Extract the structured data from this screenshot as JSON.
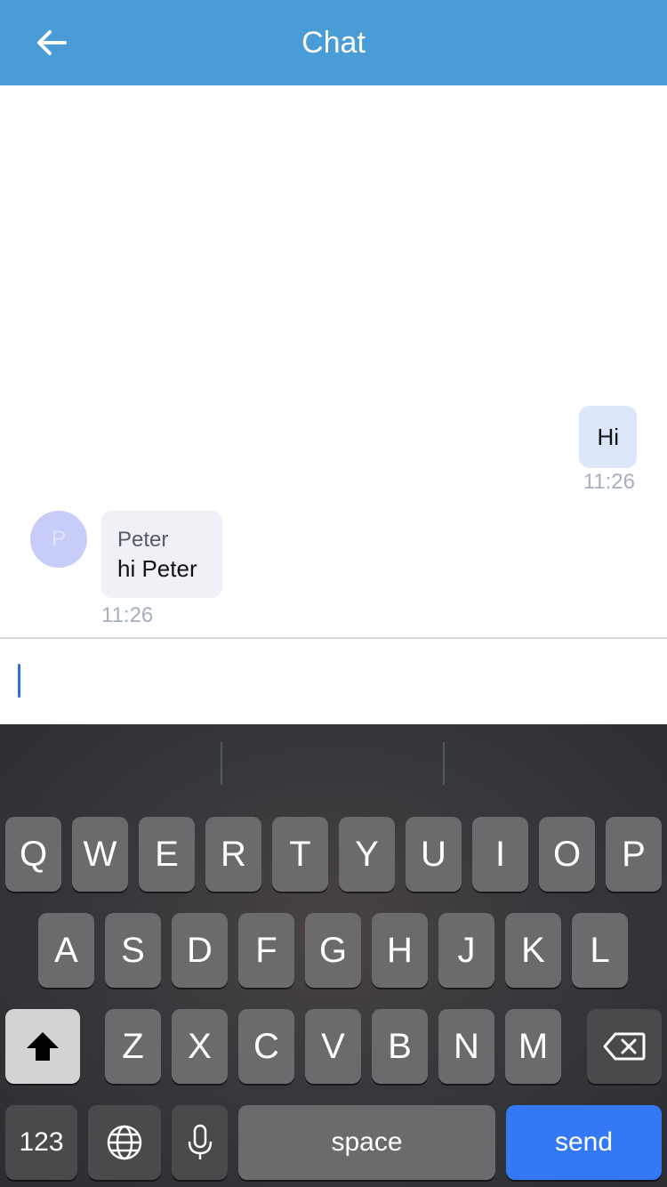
{
  "header": {
    "title": "Chat",
    "back_icon": "arrow-left-icon"
  },
  "messages": [
    {
      "direction": "outgoing",
      "text": "Hi",
      "time": "11:26"
    },
    {
      "direction": "incoming",
      "sender": "Peter",
      "avatar_initial": "P",
      "text": "hi Peter",
      "time": "11:26"
    }
  ],
  "composer": {
    "value": ""
  },
  "keyboard": {
    "row1": [
      "Q",
      "W",
      "E",
      "R",
      "T",
      "Y",
      "U",
      "I",
      "O",
      "P"
    ],
    "row2": [
      "A",
      "S",
      "D",
      "F",
      "G",
      "H",
      "J",
      "K",
      "L"
    ],
    "row3": [
      "Z",
      "X",
      "C",
      "V",
      "B",
      "N",
      "M"
    ],
    "numbers_label": "123",
    "space_label": "space",
    "send_label": "send",
    "icons": {
      "shift": "shift-icon",
      "backspace": "backspace-icon",
      "globe": "globe-icon",
      "mic": "microphone-icon"
    }
  },
  "colors": {
    "header": "#4a9cd6",
    "outgoing_bubble": "#dbe7f8",
    "incoming_bubble": "#eff1f6",
    "send_key": "#3478f6"
  }
}
